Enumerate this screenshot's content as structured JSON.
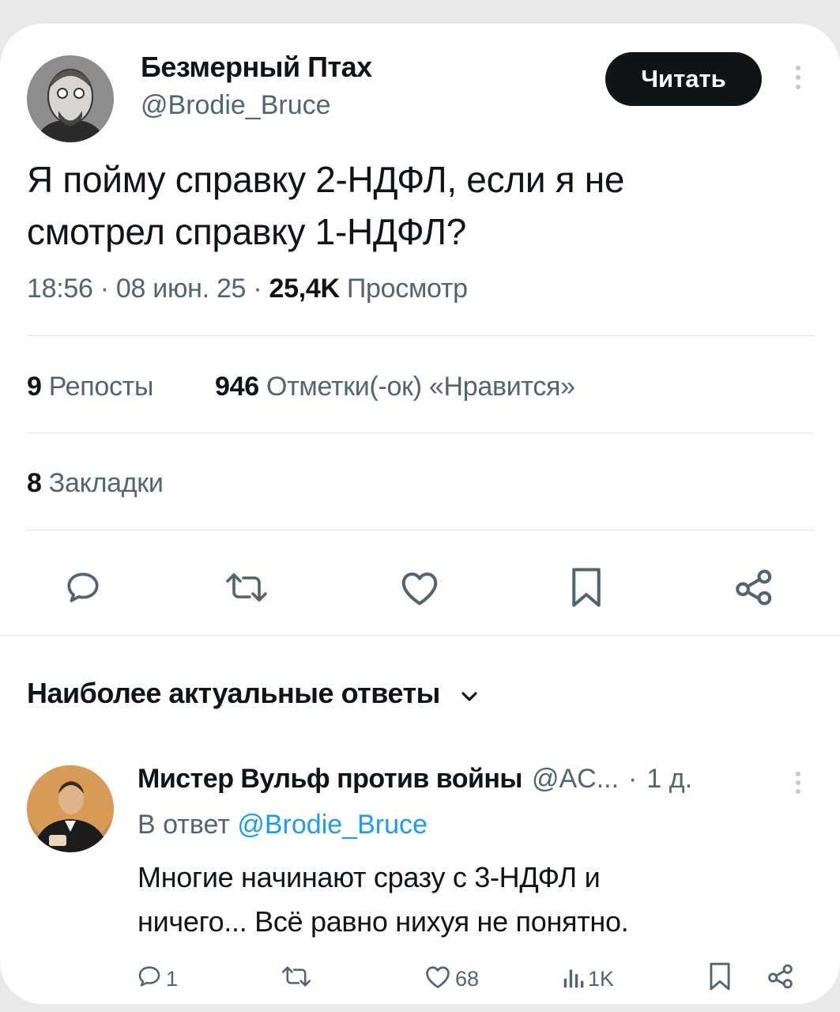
{
  "tweet": {
    "author_name": "Безмерный Птах",
    "author_handle": "@Brodie_Bruce",
    "follow_label": "Читать",
    "text_line1": "Я пойму справку 2-НДФЛ, если я не",
    "text_line2": "смотрел справку 1-НДФЛ?",
    "time": "18:56",
    "date": "08 июн. 25",
    "views_count": "25,4K",
    "views_label": "Просмотр",
    "reposts_count": "9",
    "reposts_label": "Репосты",
    "likes_count": "946",
    "likes_label": "Отметки(-ок) «Нравится»",
    "bookmarks_count": "8",
    "bookmarks_label": "Закладки"
  },
  "replies_section": {
    "title": "Наиболее актуальные ответы"
  },
  "reply": {
    "author_name": "Мистер Вульф против войны",
    "author_handle": "@AC...",
    "age": "1 д.",
    "in_reply_prefix": "В ответ",
    "in_reply_handle": "@Brodie_Bruce",
    "text_line1": "Многие начинают сразу с 3-НДФЛ и",
    "text_line2": "ничего... Всё равно нихуя не понятно.",
    "reply_count": "1",
    "like_count": "68",
    "view_count": "1K"
  },
  "icons": [
    "reply-icon",
    "repost-icon",
    "like-icon",
    "bookmark-icon",
    "share-icon",
    "chevron-down-icon",
    "more-icon",
    "views-icon"
  ],
  "colors": {
    "link": "#1d9bf0",
    "text": "#0f1419",
    "muted": "#536471",
    "button_bg": "#0f1419"
  }
}
